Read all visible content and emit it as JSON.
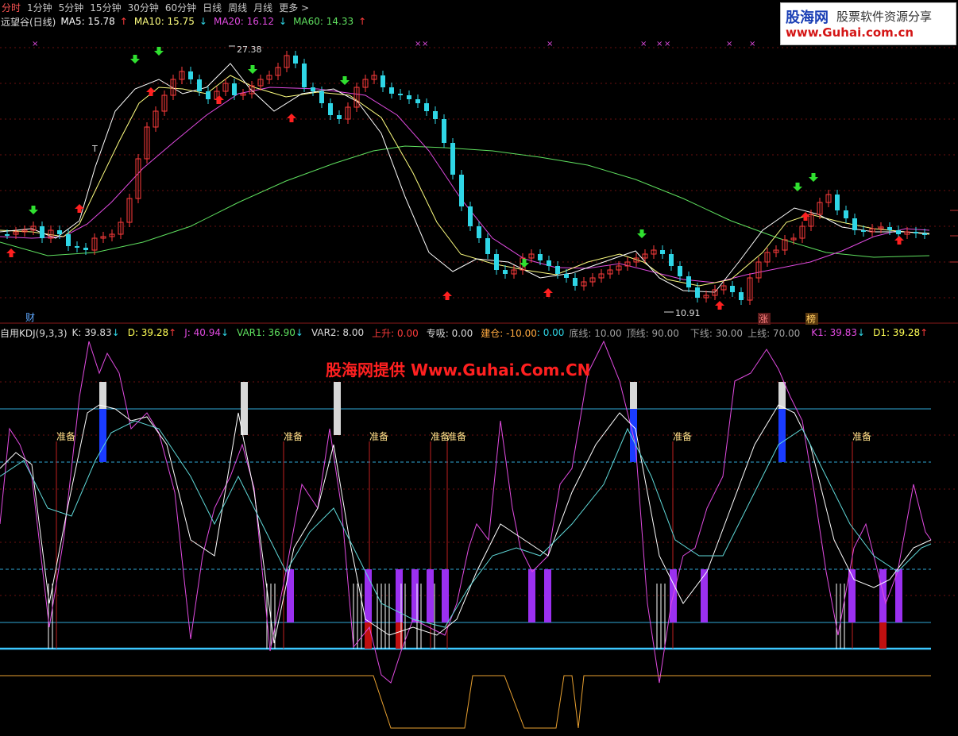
{
  "tabs": [
    "分时",
    "1分钟",
    "5分钟",
    "15分钟",
    "30分钟",
    "60分钟",
    "日线",
    "周线",
    "月线",
    "更多 >"
  ],
  "main": {
    "title": "远望谷(日线)",
    "ma": [
      {
        "label": "MA5: 15.78",
        "arrow": "↑",
        "color": "#ffffff",
        "arrow_color": "#ff3c3c"
      },
      {
        "label": "MA10: 15.75",
        "arrow": "↓",
        "color": "#ffff80",
        "arrow_color": "#2fd6e6"
      },
      {
        "label": "MA20: 16.12",
        "arrow": "↓",
        "color": "#e14be1",
        "arrow_color": "#2fd6e6"
      },
      {
        "label": "MA60: 14.33",
        "arrow": "↑",
        "color": "#5fe05f",
        "arrow_color": "#ff3c3c"
      }
    ],
    "high_label": "27.38",
    "low_label": "10.91",
    "marker_cai": "财",
    "marker_zhang": "涨",
    "marker_bang": "榜",
    "marker_t": "T"
  },
  "kdj": {
    "title": "自用KDJ(9,3,3)",
    "k": "K: 39.83",
    "k_arrow": "↓",
    "d": "D: 39.28",
    "d_arrow": "↑",
    "j": "J: 40.94",
    "j_arrow": "↓",
    "var1": "VAR1: 36.90",
    "var1_arrow": "↓",
    "var2": "VAR2: 8.00",
    "up": "上升: 0.00",
    "zx": "专吸: 0.00",
    "jc": "建仓: -10.00",
    "dot": ": 0.00",
    "dx": "底线: 10.00",
    "topx": "顶线: 90.00",
    "xx": "下线: 30.00",
    "sx": "上线: 70.00",
    "k1": "K1: 39.83",
    "k1_arrow": "↓",
    "d1": "D1: 39.28",
    "d1_arrow": "↑",
    "prepare": "准备"
  },
  "watermark": "股海网提供 Www.Guhai.Com.CN",
  "logo": {
    "name": "股海网",
    "slogan": "股票软件资源分享",
    "url": "www.Guhai.com.cn"
  },
  "colors": {
    "up": "#ff3c3c",
    "down": "#2fd6e6",
    "ma5": "#ffffff",
    "ma10": "#ffff80",
    "ma20": "#e14be1",
    "ma60": "#5fe05f"
  }
}
